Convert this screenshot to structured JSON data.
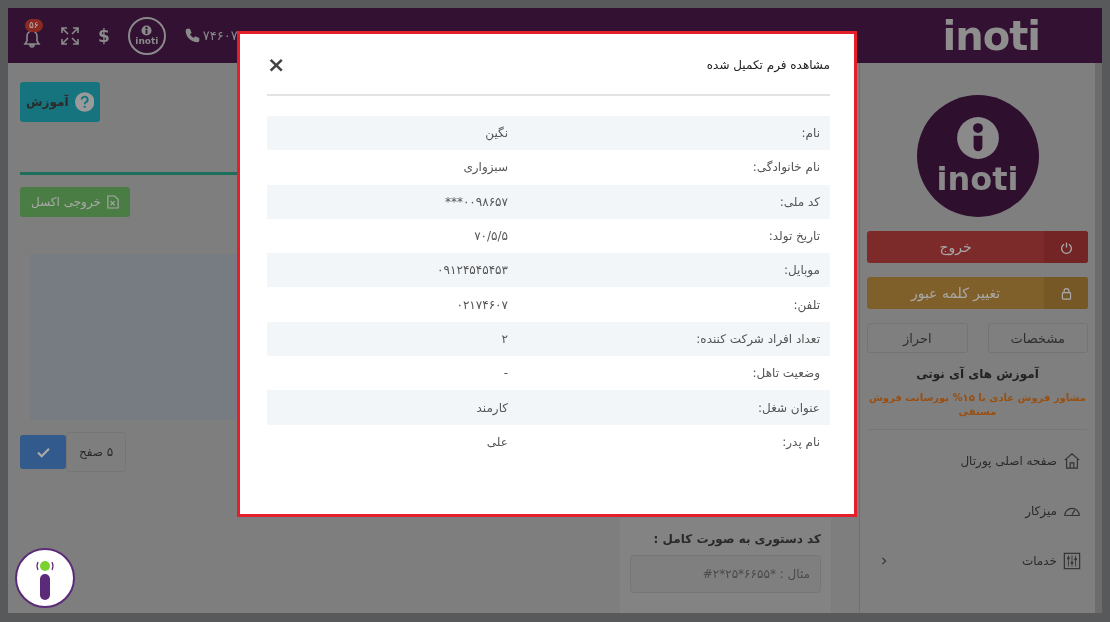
{
  "top_bar": {
    "brand": "inoti",
    "notification_count": "۵۶",
    "currency_symbol": "$",
    "logo_text": "inoti",
    "phone": "۷۴۶۰۷"
  },
  "sidebar": {
    "logo_text": "inoti",
    "logout": "خروج",
    "change_password": "تغییر کلمه عبور",
    "buttons": [
      "مشخصات",
      "احراز"
    ],
    "training_title": "آموزش های آی نوتی",
    "promo": "مشاور فروش عادی با ۱۵% پورسانت فروش مستقی",
    "nav": [
      {
        "label": "صفحه اصلی پورتال",
        "kind": "home",
        "expandable": false
      },
      {
        "label": "میزکار",
        "kind": "dashboard",
        "expandable": false
      },
      {
        "label": "خدمات",
        "kind": "services",
        "expandable": true
      }
    ]
  },
  "content": {
    "help_button": "آموزش",
    "export_button": "خروجی اکسل",
    "pager_text": "۵ صفح",
    "ussd": {
      "label": "کد دستوری به صورت کامل :",
      "placeholder": "مثال : *۶۶۵۵*۲۵*۲#"
    }
  },
  "modal": {
    "title": "مشاهده فرم تکمیل شده",
    "close": "×",
    "rows": [
      {
        "label": "نام:",
        "value": "نگین"
      },
      {
        "label": "نام خانوادگی:",
        "value": "سبزواری"
      },
      {
        "label": "کد ملی:",
        "value": "۰۰۹۸۶۵۷***"
      },
      {
        "label": "تاریخ تولد:",
        "value": "۷۰/۵/۵"
      },
      {
        "label": "موبایل:",
        "value": "۰۹۱۲۴۵۴۵۴۵۳"
      },
      {
        "label": "تلفن:",
        "value": "۰۲۱۷۴۶۰۷"
      },
      {
        "label": "تعداد افراد شرکت کننده:",
        "value": "۲"
      },
      {
        "label": "وضعیت تاهل:",
        "value": "-"
      },
      {
        "label": "عنوان شغل:",
        "value": "کارمند"
      },
      {
        "label": "نام پدر:",
        "value": "علی"
      }
    ]
  }
}
